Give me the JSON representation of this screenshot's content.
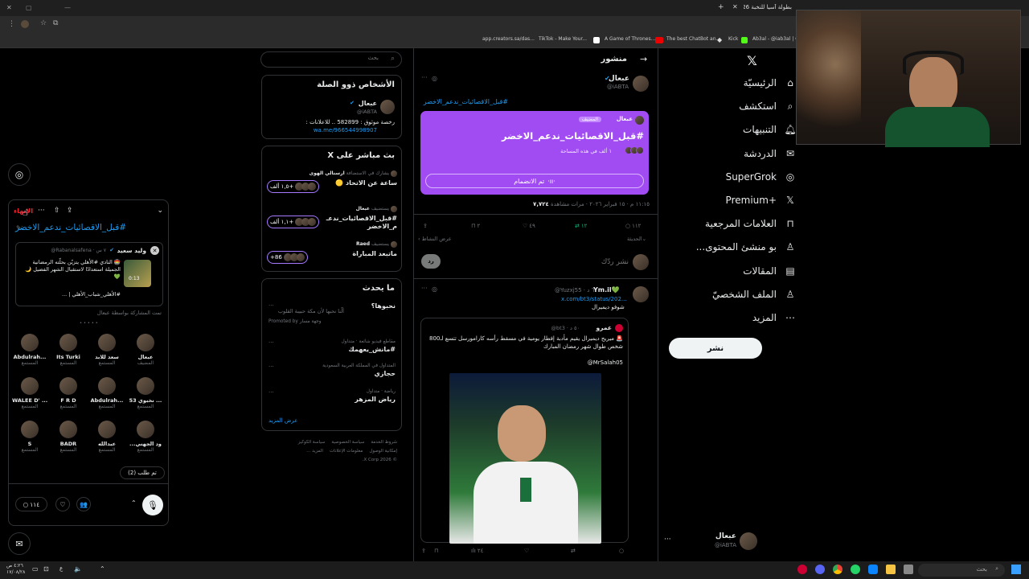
{
  "browser": {
    "tab_title": "بطولة آسيا للنخبة 25/26 ...",
    "bookmarks": [
      "app.creators.sa/das...",
      "TikTok - Make Your...",
      "A Game of Thrones...",
      "The best ChatBot an...",
      "Kick",
      "Ab3al - @iab3al | G..."
    ]
  },
  "nav": {
    "items": [
      {
        "label": "الرئيسيّة",
        "icon": "home-icon"
      },
      {
        "label": "استكشف",
        "icon": "search-icon"
      },
      {
        "label": "التنبيهات",
        "icon": "bell-icon"
      },
      {
        "label": "الدردشة",
        "icon": "chat-icon"
      },
      {
        "label": "SuperGrok",
        "icon": "grok-icon"
      },
      {
        "label": "Premium+",
        "icon": "x-icon"
      },
      {
        "label": "العلامات المرجعية",
        "icon": "bookmark-icon"
      },
      {
        "label": "...بو منشئ المحتوى",
        "icon": "creator-icon"
      },
      {
        "label": "المقالات",
        "icon": "article-icon"
      },
      {
        "label": "الملف الشخصيّ",
        "icon": "profile-icon"
      },
      {
        "label": "المزيد",
        "icon": "more-icon"
      }
    ],
    "post_label": "نشر",
    "account": {
      "name": "عبعال",
      "handle": "@iABTA"
    }
  },
  "main": {
    "header_title": "منشور",
    "post": {
      "author": "عبعال",
      "handle": "@iABTA",
      "hashtag": "#قبل_الاقصائيات_ندعم_الاخضر",
      "space": {
        "host": "عبعال",
        "role": "المضيف",
        "title": "#قبل_الاقصائيات_ندعم_الاخضر",
        "listening": "١ ألف في هذه المساحة",
        "joined_label": "تم الانضمام"
      },
      "meta": "١١:١٥ م · ١٥ فبراير ٢٠٢٦ · مرات مشاهدة",
      "views": "٧,٧٢٤",
      "stats": {
        "replies": "١١٢",
        "reposts": "١٢",
        "likes": "٤٩",
        "bookmarks": "٢"
      },
      "activity_label": "عرض النشاط",
      "relevance_label": "الحديثة",
      "reply_placeholder": "نشر ردّك",
      "reply_button": "رد"
    },
    "reply": {
      "author": "Ym.il💚",
      "handle": "@Yuzxj55 · ٦ د",
      "link": "x.com/bt3/status/202...",
      "text": "شوفو ديميرال",
      "quote": {
        "author": "عمرو",
        "handle": "@bt3 · ٥٠ د",
        "text": "🚨 ميريح ديميرال يقيم مأدبة إفطار يومية في مسقط رأسه كارامورسل تتسع لـ800 شخص طوال شهر رمضان المبارك",
        "mention": "@MrSalah05"
      },
      "stats": {
        "views": "٢٤"
      }
    }
  },
  "sidebar": {
    "search_placeholder": "بحث",
    "related_title": "الأشخاص ذوو الصلة",
    "related": {
      "name": "عبعال",
      "handle": "@iABTA",
      "bio": "رخصة موثوق : 582899 .. للاعلانات :",
      "link": "wa.me/966544998907"
    },
    "live_title": "X بث مباشر على",
    "live": [
      {
        "host": "ارسنالي الهوى",
        "status": "يشارك في الاستضافة",
        "title": "ساعة عن الاتحاد 🟡",
        "count": "١,٥ ألف+"
      },
      {
        "host": "عبعال",
        "status": "يستضيف",
        "title": "#قبل_الاقصائيات_ندعـ م_الاخضر",
        "count": "١,١ ألف+"
      },
      {
        "host": "Raed",
        "status": "يستضيف",
        "title": "ماتبعد المباراة",
        "count": "+86"
      }
    ],
    "trends_title": "ما يحدث",
    "trends": [
      {
        "context": "",
        "title": "نحبوها؟",
        "desc": "ألّنا نحبها لأن مكة حبيبة القلوب",
        "promoted": "Promoted by وجهة مسار"
      },
      {
        "context": "مقاطع فيديو شائعة · متداول",
        "title": "#مانش_يعهمك",
        "desc": "",
        "promoted": ""
      },
      {
        "context": "المتداول في المملكة العربية السعودية",
        "title": "حجازي",
        "desc": "",
        "promoted": ""
      },
      {
        "context": "رياضة · متداول",
        "title": "رياض المزهر",
        "desc": "",
        "promoted": ""
      }
    ],
    "show_more": "عرض المزيد",
    "footer": [
      "شروط الخدمة",
      "سياسة الخصوصية",
      "سياسة الكوكيز",
      "إمكانية الوصول",
      "معلومات الإعلانات",
      "المزيد ...",
      "© 2026 X Corp."
    ]
  },
  "dock": {
    "leave_label": "الإنهاء",
    "title": "#قبل_الاقصائيات_ندعم_الاخضر",
    "pinned": {
      "author": "وليد سعيد",
      "handle": "@Rabanalsafena · ٧ س",
      "text": "🏟️ النادي #الأهلي يتزيّن بحلّته الرمضانية الجميلة استعدادًا لاستقبال الشهر الفضيل 🌙💚",
      "tags": "#الأهلي_شباب_الأهلي | ...",
      "duration": "0:13",
      "shared_by": "تمت المشاركة بواسطة عبعال"
    },
    "listeners": [
      {
        "name": "عبعال",
        "role": "المضيف"
      },
      {
        "name": "سعد للابد",
        "role": "المستمع"
      },
      {
        "name": "Its Turki",
        "role": "المستمع"
      },
      {
        "name": "Abdulrah...",
        "role": "المستمع"
      },
      {
        "name": "53 نخبوي ...",
        "role": "المستمع"
      },
      {
        "name": "Abdulrah...",
        "role": "المستمع"
      },
      {
        "name": "F R D",
        "role": "المستمع"
      },
      {
        "name": "WALEE D' ...",
        "role": "المستمع"
      },
      {
        "name": "...ود الجهني",
        "role": "المستمع"
      },
      {
        "name": "عبدالله",
        "role": "المستمع"
      },
      {
        "name": "BADR",
        "role": "المستمع"
      },
      {
        "name": "S",
        "role": "المستمع"
      }
    ],
    "requests_label": "تم طلب (2)",
    "reply_count": "١١٤"
  },
  "taskbar": {
    "time": "٤:٢٦ ص",
    "date": "١٧/٠٨/٢٨",
    "search_placeholder": "بحث",
    "lang": "ع"
  },
  "colors": {
    "accent": "#1d9bf0",
    "space": "#a14cf3",
    "green": "#00ba7c"
  }
}
